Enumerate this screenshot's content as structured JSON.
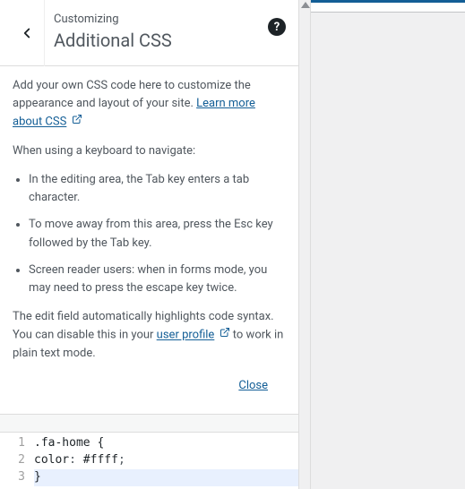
{
  "header": {
    "overline": "Customizing",
    "title": "Additional CSS"
  },
  "intro": {
    "text_before": "Add your own CSS code here to customize the appearance and layout of your site. ",
    "learn_link": "Learn more about CSS"
  },
  "keyboard_hint": "When using a keyboard to navigate:",
  "tips": [
    "In the editing area, the Tab key enters a tab character.",
    "To move away from this area, press the Esc key followed by the Tab key.",
    "Screen reader users: when in forms mode, you may need to press the escape key twice."
  ],
  "syntax": {
    "before": "The edit field automatically highlights code syntax. You can disable this in your ",
    "profile_link": "user profile",
    "after": " to work in plain text mode."
  },
  "close_label": "Close",
  "code": {
    "line1": {
      "selector": ".fa-home",
      "brace": "{"
    },
    "line2": {
      "prop": "color",
      "colon": ":",
      "value": "#ffff",
      "semi": ";"
    },
    "line3": {
      "brace": "}"
    },
    "line_numbers": [
      "1",
      "2",
      "3"
    ]
  }
}
